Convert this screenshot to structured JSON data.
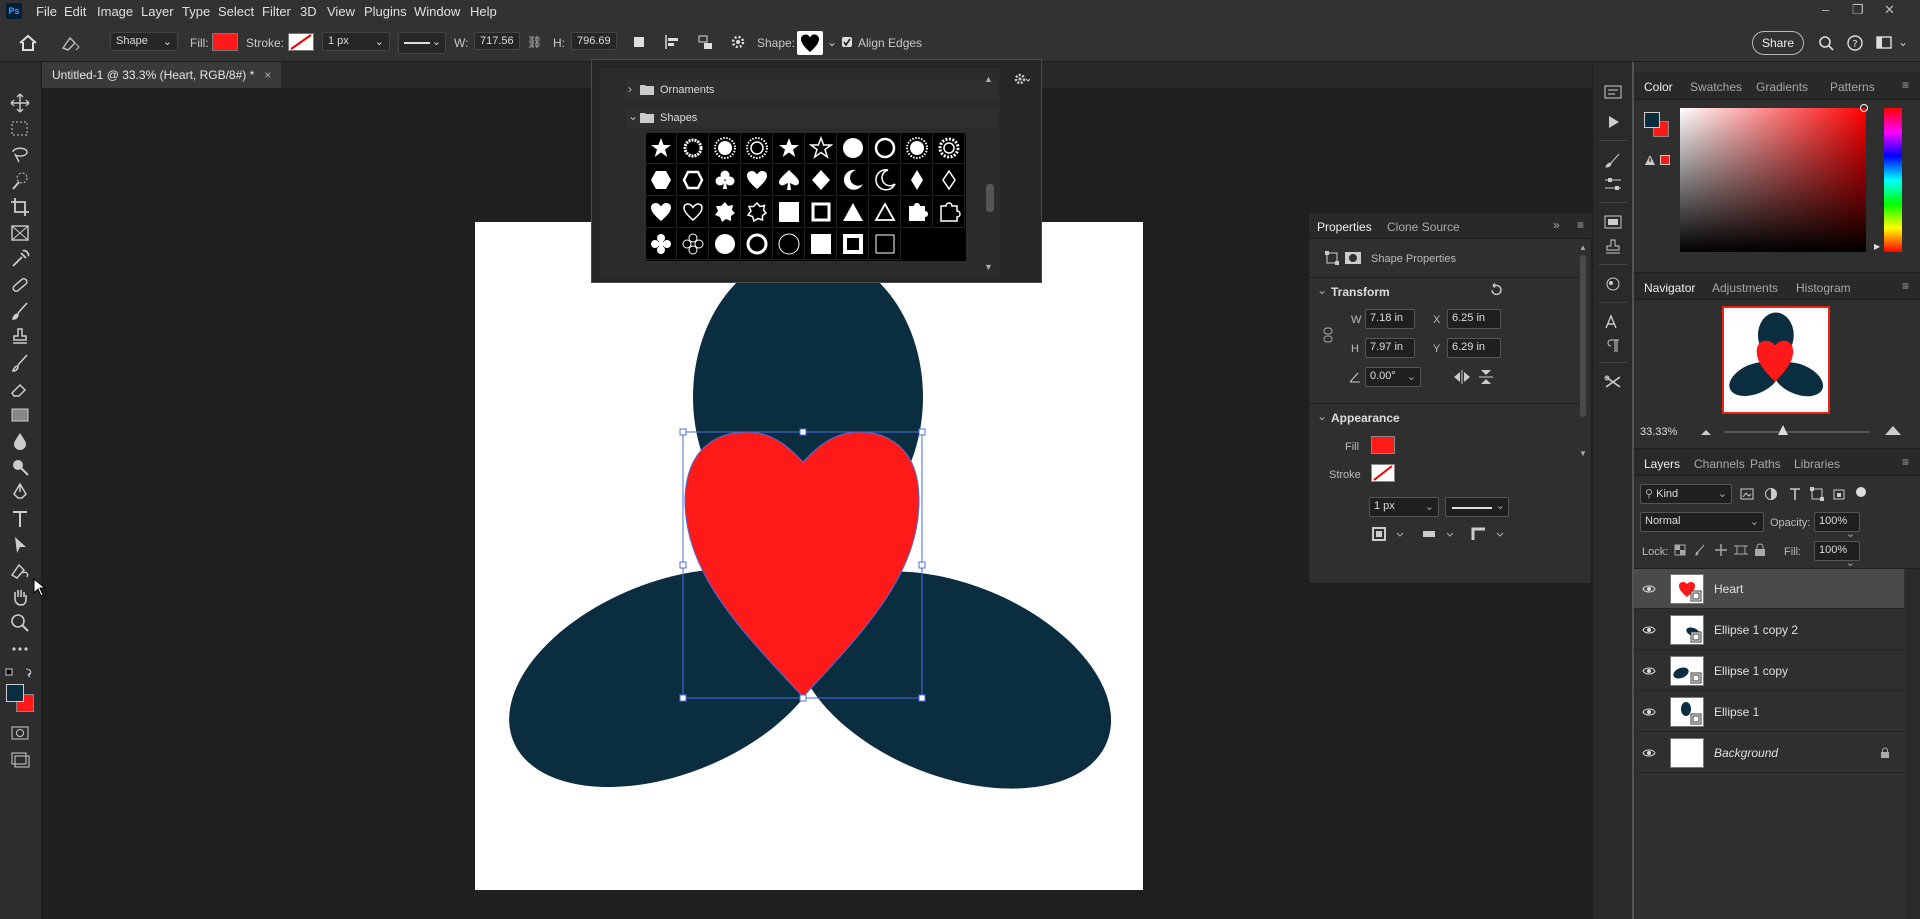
{
  "menubar": {
    "logo": "Ps",
    "items": [
      "File",
      "Edit",
      "Image",
      "Layer",
      "Type",
      "Select",
      "Filter",
      "3D",
      "View",
      "Plugins",
      "Window",
      "Help"
    ]
  },
  "options": {
    "mode": "Shape",
    "fill_label": "Fill:",
    "fill_color": "#ff1a1a",
    "stroke_label": "Stroke:",
    "stroke_width": "1 px",
    "w_label": "W:",
    "w_value": "717.56",
    "h_label": "H:",
    "h_value": "796.69",
    "shape_label": "Shape:",
    "align_edges": "Align Edges",
    "share": "Share"
  },
  "doc_tab": {
    "title": "Untitled-1 @ 33.3% (Heart, RGB/8#) *",
    "close": "×"
  },
  "shape_picker": {
    "groups": [
      {
        "name": "Ornaments",
        "expanded": false
      },
      {
        "name": "Shapes",
        "expanded": true
      }
    ],
    "shapes": [
      "star",
      "sun-ring",
      "starburst",
      "spiky-burst",
      "star-filled",
      "star-outline",
      "seal",
      "seal-outline",
      "starburst-2",
      "gear-burst",
      "hexagon",
      "hexagon-outline",
      "club",
      "heart",
      "spade",
      "diamond",
      "crescent",
      "crescent-outline",
      "diamond-2",
      "diamond-outline",
      "heart",
      "heart-outline",
      "octagram",
      "octagram-outline",
      "square",
      "square-frame",
      "triangle",
      "triangle-outline",
      "puzzle",
      "puzzle-outline",
      "flower",
      "flower-outline",
      "circle",
      "circle-ring",
      "circle-outline",
      "square-2",
      "square-frame-2",
      "square-outline"
    ]
  },
  "properties": {
    "tabs": [
      "Properties",
      "Clone Source"
    ],
    "active_tab": "Properties",
    "subtitle": "Shape Properties",
    "transform_title": "Transform",
    "w_label": "W",
    "w": "7.18 in",
    "x_label": "X",
    "x": "6.25 in",
    "h_label": "H",
    "h": "7.97 in",
    "y_label": "Y",
    "y": "6.29 in",
    "angle": "0.00°",
    "appearance_title": "Appearance",
    "fill_label": "Fill",
    "fill_color": "#ff1a1a",
    "stroke_label": "Stroke",
    "stroke_width": "1 px"
  },
  "color_panel": {
    "tabs": [
      "Color",
      "Swatches",
      "Gradients",
      "Patterns"
    ],
    "active_tab": "Color",
    "foreground": "#0b2d40",
    "background": "#ff1a1a"
  },
  "navigator": {
    "tabs": [
      "Navigator",
      "Adjustments",
      "Histogram"
    ],
    "active_tab": "Navigator",
    "zoom": "33.33%"
  },
  "layers_panel": {
    "tabs": [
      "Layers",
      "Channels",
      "Paths",
      "Libraries"
    ],
    "active_tab": "Layers",
    "filter": "Kind",
    "blend_mode": "Normal",
    "opacity_label": "Opacity:",
    "opacity": "100%",
    "lock_label": "Lock:",
    "fill_label": "Fill:",
    "fill": "100%",
    "layers": [
      {
        "name": "Heart",
        "selected": true
      },
      {
        "name": "Ellipse 1 copy 2",
        "selected": false
      },
      {
        "name": "Ellipse 1 copy",
        "selected": false
      },
      {
        "name": "Ellipse 1",
        "selected": false
      },
      {
        "name": "Background",
        "selected": false,
        "locked": true
      }
    ]
  },
  "canvas": {
    "ellipse_color": "#0b2d40",
    "heart_color": "#ff1a1a"
  }
}
